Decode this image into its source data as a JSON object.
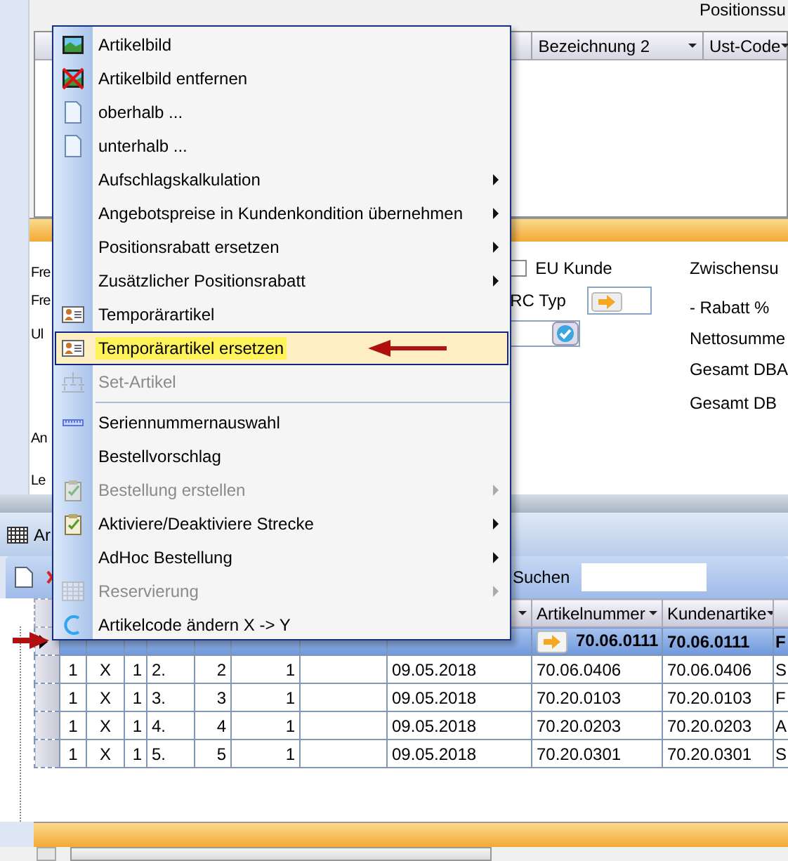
{
  "upper_panel": {
    "summary_caption": "Positionssu",
    "table_headers": [
      {
        "text": "Bezeichnung 2",
        "dropdown": true
      },
      {
        "text": "Ust-Code",
        "dropdown": true
      }
    ],
    "form_labels": [
      "Fre",
      "Fre",
      "Ul",
      "An",
      "Le"
    ],
    "eu_customer": {
      "label": "EU Kunde",
      "checked": false
    },
    "rc_type_label": "RC Typ",
    "totals_labels": [
      "Zwischensu",
      "- Rabatt %",
      "Nettosumme",
      "Gesamt DBA",
      "Gesamt DB"
    ]
  },
  "lower_window": {
    "title": "Ar",
    "search_label": "Suchen",
    "grid": {
      "headers": [
        {
          "dropdown": true
        },
        {
          "text": "Artikelnummer",
          "dropdown": true
        },
        {
          "text": "Kundenartike",
          "dropdown": true
        }
      ],
      "rows": [
        {
          "selected": true,
          "lookup": true,
          "cells": [
            null,
            null,
            null,
            null,
            null,
            null,
            null,
            null,
            "70.06.0111",
            "70.06.0111",
            "F"
          ]
        },
        {
          "selected": false,
          "lookup": false,
          "cells": [
            "1",
            "X",
            "1",
            "2.",
            "2",
            "1",
            null,
            "09.05.2018",
            "70.06.0406",
            "70.06.0406",
            "S"
          ]
        },
        {
          "selected": false,
          "lookup": false,
          "cells": [
            "1",
            "X",
            "1",
            "3.",
            "3",
            "1",
            null,
            "09.05.2018",
            "70.20.0103",
            "70.20.0103",
            "F"
          ]
        },
        {
          "selected": false,
          "lookup": false,
          "cells": [
            "1",
            "X",
            "1",
            "4.",
            "4",
            "1",
            null,
            "09.05.2018",
            "70.20.0203",
            "70.20.0203",
            "A"
          ]
        },
        {
          "selected": false,
          "lookup": false,
          "cells": [
            "1",
            "X",
            "1",
            "5.",
            "5",
            "1",
            null,
            "09.05.2018",
            "70.20.0301",
            "70.20.0301",
            "S"
          ]
        }
      ]
    }
  },
  "context_menu": {
    "items": [
      {
        "kind": "item",
        "label": "Artikelbild",
        "submenu": false,
        "disabled": false,
        "selected": false
      },
      {
        "kind": "item",
        "label": "Artikelbild entfernen",
        "submenu": false,
        "disabled": false,
        "selected": false
      },
      {
        "kind": "item",
        "label": "oberhalb ...",
        "submenu": false,
        "disabled": false,
        "selected": false
      },
      {
        "kind": "item",
        "label": "unterhalb ...",
        "submenu": false,
        "disabled": false,
        "selected": false
      },
      {
        "kind": "item",
        "label": "Aufschlagskalkulation",
        "submenu": true,
        "disabled": false,
        "selected": false
      },
      {
        "kind": "item",
        "label": "Angebotspreise in Kundenkondition übernehmen",
        "submenu": true,
        "disabled": false,
        "selected": false
      },
      {
        "kind": "item",
        "label": "Positionsrabatt ersetzen",
        "submenu": true,
        "disabled": false,
        "selected": false
      },
      {
        "kind": "item",
        "label": "Zusätzlicher Positionsrabatt",
        "submenu": true,
        "disabled": false,
        "selected": false
      },
      {
        "kind": "item",
        "label": "Temporärartikel",
        "submenu": false,
        "disabled": false,
        "selected": false
      },
      {
        "kind": "item",
        "label": "Temporärartikel ersetzen",
        "submenu": false,
        "disabled": false,
        "selected": true
      },
      {
        "kind": "item",
        "label": "Set-Artikel",
        "submenu": false,
        "disabled": true,
        "selected": false
      },
      {
        "kind": "separator"
      },
      {
        "kind": "item",
        "label": "Seriennummernauswahl",
        "submenu": false,
        "disabled": false,
        "selected": false
      },
      {
        "kind": "item",
        "label": "Bestellvorschlag",
        "submenu": false,
        "disabled": false,
        "selected": false
      },
      {
        "kind": "item",
        "label": "Bestellung erstellen",
        "submenu": true,
        "disabled": true,
        "selected": false
      },
      {
        "kind": "item",
        "label": "Aktiviere/Deaktiviere Strecke",
        "submenu": true,
        "disabled": false,
        "selected": false
      },
      {
        "kind": "item",
        "label": "AdHoc Bestellung",
        "submenu": true,
        "disabled": false,
        "selected": false
      },
      {
        "kind": "item",
        "label": "Reservierung",
        "submenu": true,
        "disabled": true,
        "selected": false
      },
      {
        "kind": "item",
        "label": "Artikelcode ändern X -> Y",
        "submenu": false,
        "disabled": false,
        "selected": false
      }
    ]
  }
}
